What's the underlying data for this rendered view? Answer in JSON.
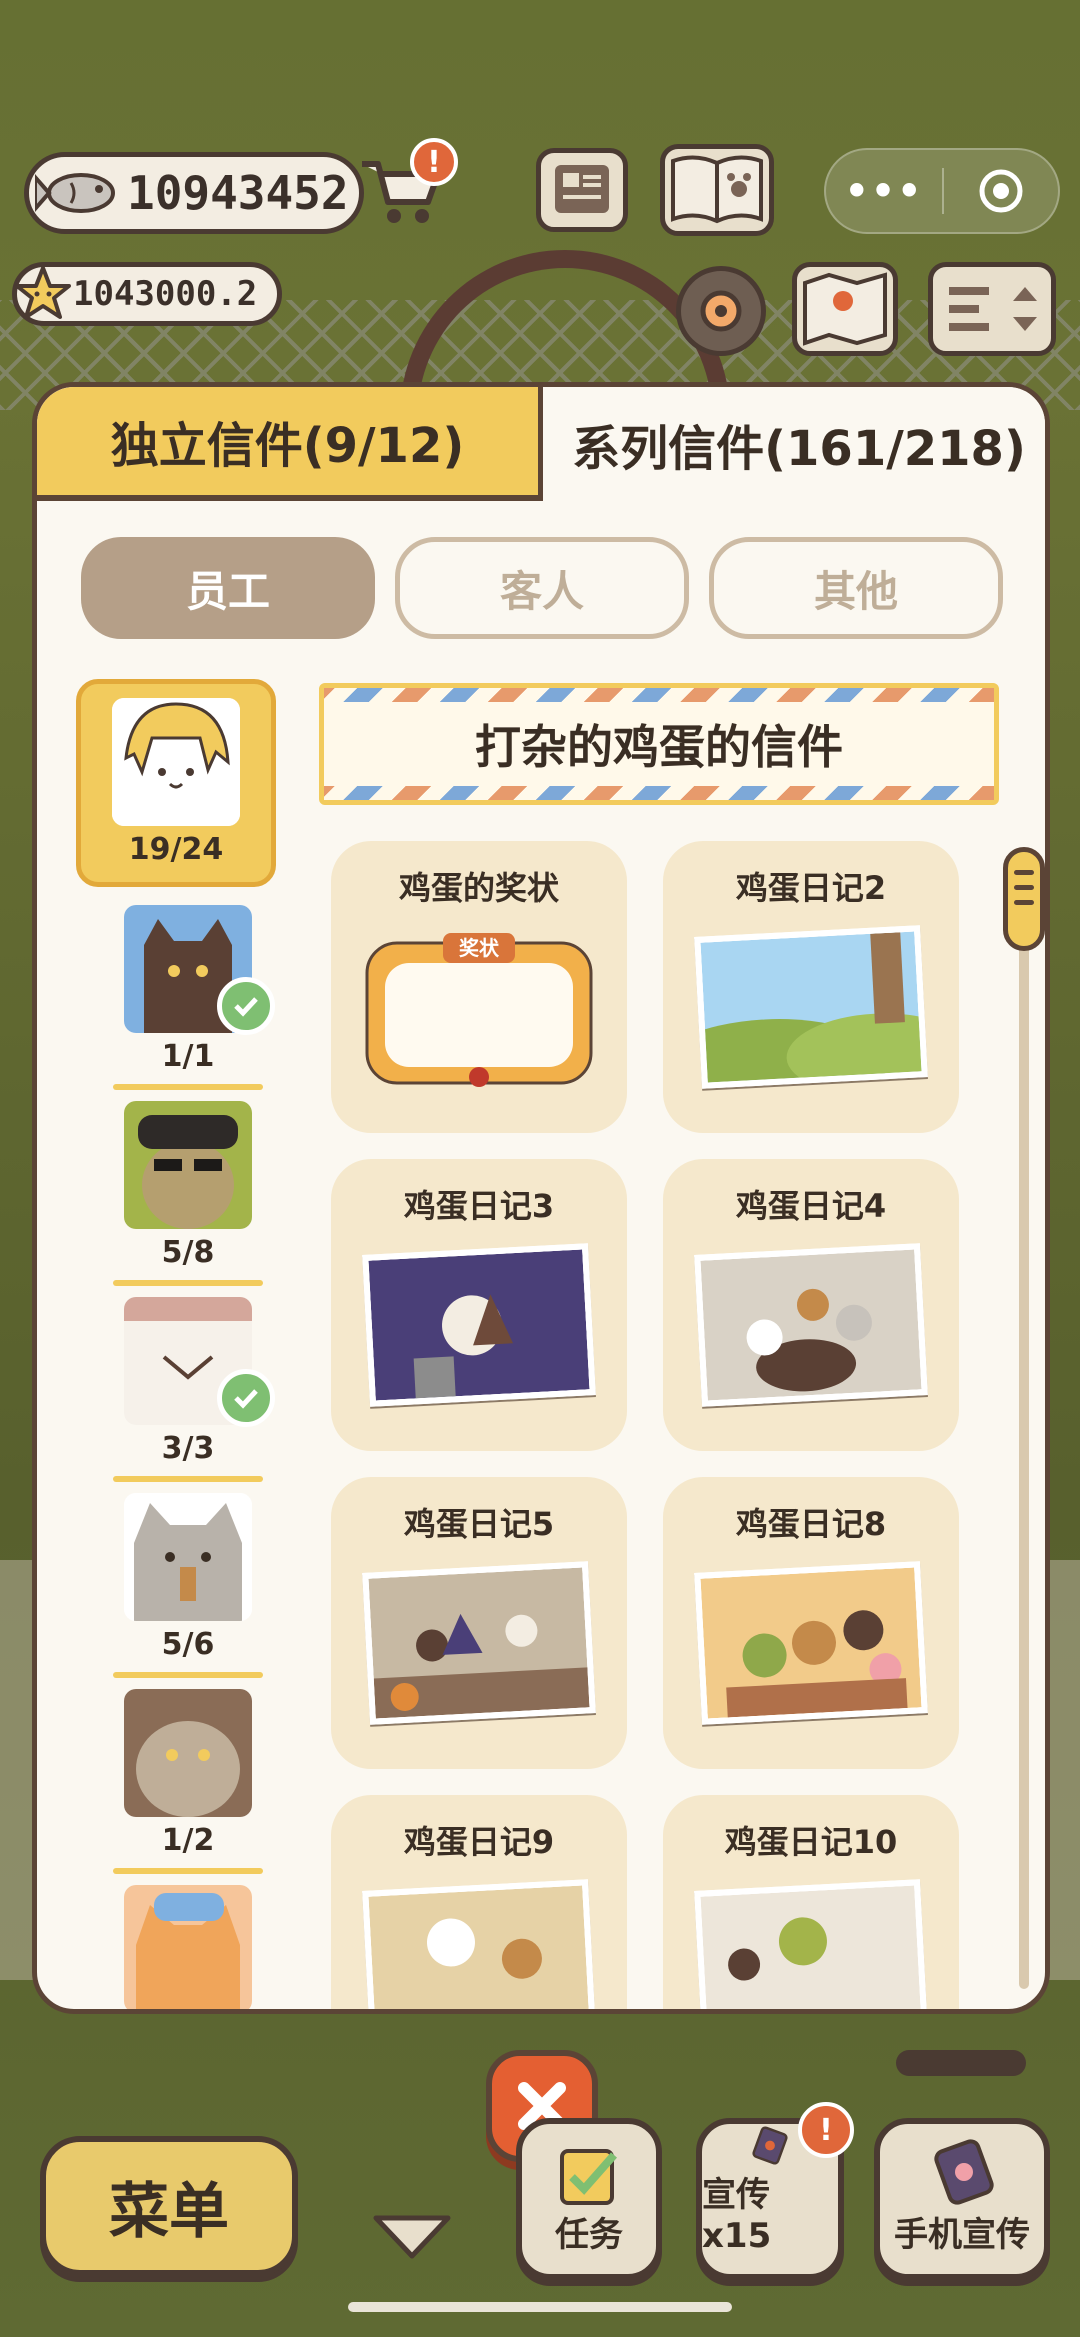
{
  "hud": {
    "fish_count": "10943452",
    "star_count": "1043000.2",
    "shop_alert": "!",
    "mini_menu_dots": "•••"
  },
  "tabs": [
    {
      "label": "独立信件(9/12)",
      "active": false
    },
    {
      "label": "系列信件(161/218)",
      "active": true
    }
  ],
  "filters": [
    {
      "label": "员工",
      "active": true
    },
    {
      "label": "客人",
      "active": false
    },
    {
      "label": "其他",
      "active": false
    }
  ],
  "characters": [
    {
      "count": "19/24",
      "selected": true,
      "complete": false
    },
    {
      "count": "1/1",
      "selected": false,
      "complete": true
    },
    {
      "count": "5/8",
      "selected": false,
      "complete": false
    },
    {
      "count": "3/3",
      "selected": false,
      "complete": true
    },
    {
      "count": "5/6",
      "selected": false,
      "complete": false
    },
    {
      "count": "1/2",
      "selected": false,
      "complete": false
    },
    {
      "count": "",
      "selected": false,
      "complete": true
    }
  ],
  "banner": {
    "title": "打杂的鸡蛋的信件"
  },
  "letters": [
    {
      "title": "鸡蛋的奖状",
      "badge": "奖状"
    },
    {
      "title": "鸡蛋日记2"
    },
    {
      "title": "鸡蛋日记3"
    },
    {
      "title": "鸡蛋日记4"
    },
    {
      "title": "鸡蛋日记5"
    },
    {
      "title": "鸡蛋日记8"
    },
    {
      "title": "鸡蛋日记9"
    },
    {
      "title": "鸡蛋日记10"
    }
  ],
  "bottom": {
    "menu_label": "菜单",
    "task_label": "任务",
    "promote_label": "宣传x15",
    "promote_alert": "!",
    "phone_promote_label": "手机宣传"
  },
  "colors": {
    "accent_yellow": "#f2cb5d",
    "panel_bg": "#fbf8f1",
    "card_bg": "#f5e8cc",
    "outline": "#5b4436",
    "close_red": "#e45f32",
    "check_green": "#7fbf72"
  }
}
